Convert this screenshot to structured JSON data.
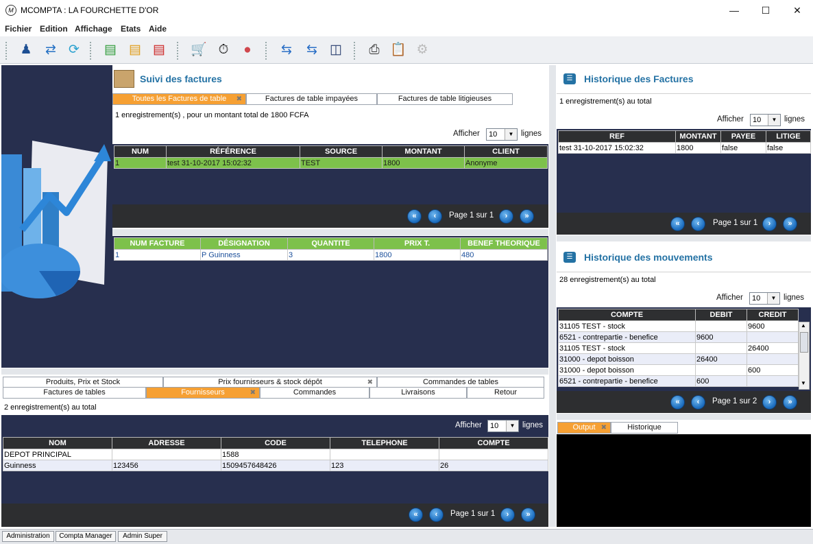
{
  "window": {
    "title": "MCOMPTA : LA FOURCHETTE D'OR",
    "minimize": "—",
    "maximize": "☐",
    "close": "✕"
  },
  "menu": [
    "Fichier",
    "Edition",
    "Affichage",
    "Etats",
    "Aide"
  ],
  "factures": {
    "title": "Suivi des factures",
    "tabs": [
      "Toutes les Factures de table",
      "Factures de table impayées",
      "Factures de table litigieuses"
    ],
    "info": "1 enregistrement(s) , pour un montant total de 1800 FCFA",
    "afficher": "Afficher",
    "lignes": "lignes",
    "page_size": "10",
    "columns": [
      "NUM",
      "RÉFÉRENCE",
      "SOURCE",
      "MONTANT",
      "CLIENT"
    ],
    "rows": [
      [
        "1",
        "test 31-10-2017 15:02:32",
        "TEST",
        "1800",
        "Anonyme"
      ]
    ],
    "page": "Page 1 sur 1"
  },
  "lignes_facture": {
    "columns": [
      "NUM FACTURE",
      "DÉSIGNATION",
      "QUANTITE",
      "PRIX T.",
      "BENEF THEORIQUE"
    ],
    "rows": [
      [
        "1",
        "P Guinness",
        "3",
        "1800",
        "480"
      ]
    ]
  },
  "bottom": {
    "tabs_row1": [
      "Produits, Prix et Stock",
      "Prix fournisseurs & stock dépôt",
      "Commandes de tables"
    ],
    "tabs_row2": [
      "Factures de tables",
      "Fournisseurs",
      "Commandes",
      "Livraisons",
      "Retour"
    ],
    "info": "2 enregistrement(s) au total",
    "afficher": "Afficher",
    "lignes": "lignes",
    "page_size": "10",
    "columns": [
      "NOM",
      "ADRESSE",
      "CODE",
      "TELEPHONE",
      "COMPTE"
    ],
    "rows": [
      [
        "DEPOT PRINCIPAL",
        "",
        "1588",
        "",
        ""
      ],
      [
        "Guinness",
        "123456",
        "1509457648426",
        "123",
        "26"
      ]
    ],
    "page": "Page 1 sur 1"
  },
  "hist_factures": {
    "title": "Historique des Factures",
    "info": "1 enregistrement(s) au total",
    "afficher": "Afficher",
    "lignes": "lignes",
    "page_size": "10",
    "columns": [
      "REF",
      "MONTANT",
      "PAYEE",
      "LITIGE"
    ],
    "rows": [
      [
        "test 31-10-2017 15:02:32",
        "1800",
        "false",
        "false"
      ]
    ],
    "page": "Page 1 sur 1"
  },
  "hist_mouvements": {
    "title": "Historique des mouvements",
    "info": "28 enregistrement(s) au total",
    "afficher": "Afficher",
    "lignes": "lignes",
    "page_size": "10",
    "columns": [
      "COMPTE",
      "DEBIT",
      "CREDIT"
    ],
    "rows": [
      [
        "31105 TEST - stock",
        "",
        "9600"
      ],
      [
        "6521 - contrepartie - benefice",
        "9600",
        ""
      ],
      [
        "31105 TEST - stock",
        "",
        "26400"
      ],
      [
        "31000 - depot boisson",
        "26400",
        ""
      ],
      [
        "31000 - depot boisson",
        "",
        "600"
      ],
      [
        "6521 - contrepartie - benefice",
        "600",
        ""
      ]
    ],
    "page": "Page 1 sur 2"
  },
  "output": {
    "tabs": [
      "Output",
      "Historique"
    ]
  },
  "status_tabs": [
    "Administration",
    "Compta Manager",
    "Admin Super"
  ]
}
